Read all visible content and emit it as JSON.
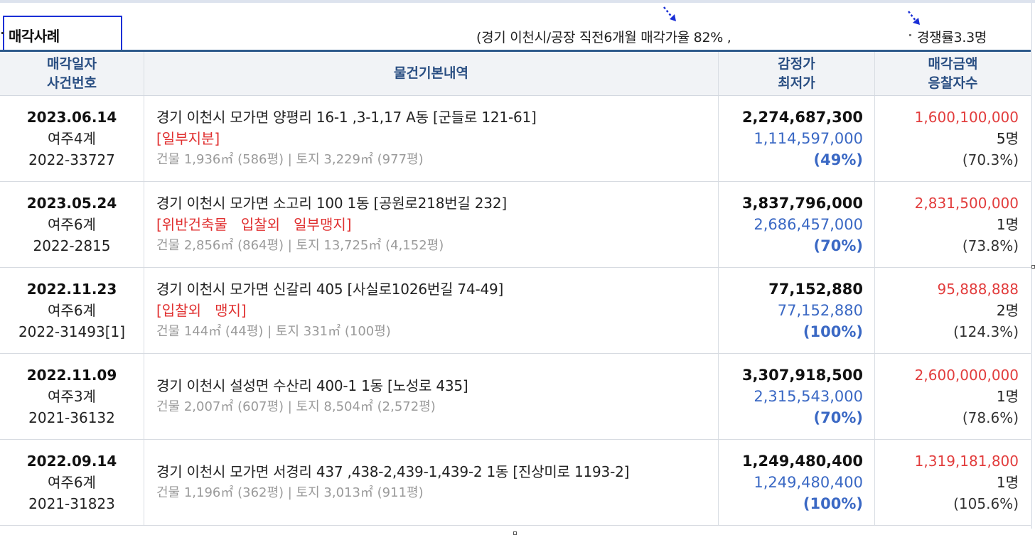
{
  "header": {
    "title": "매각사례",
    "summary": "(경기 이천시/공장 직전6개월 매각가율 82% ,",
    "competition": "경쟁률3.3명",
    "accent_color": "#1a2fd6"
  },
  "columns": {
    "date": [
      "매각일자",
      "사건번호"
    ],
    "info": "물건기본내역",
    "price": [
      "감정가",
      "최저가"
    ],
    "sale": [
      "매각금액",
      "응찰자수"
    ]
  },
  "rows": [
    {
      "date": "2023.06.14",
      "court": "여주4계",
      "case": "2022-33727",
      "address": "경기 이천시 모가면 양평리 16-1 ,3-1,17 A동 [군들로 121-61]",
      "tags": "[일부지분]",
      "area": "건물 1,936㎡ (586평) | 토지 3,229㎡ (977평)",
      "appraisal": "2,274,687,300",
      "minimum": "1,114,597,000",
      "min_pct": "(49%)",
      "sale_price": "1,600,100,000",
      "bidders": "5명",
      "ratio": "(70.3%)"
    },
    {
      "date": "2023.05.24",
      "court": "여주6계",
      "case": "2022-2815",
      "address": "경기 이천시 모가면 소고리 100 1동 [공원로218번길 232]",
      "tags": "[위반건축물   입찰외   일부맹지]",
      "area": "건물 2,856㎡ (864평) | 토지 13,725㎡ (4,152평)",
      "appraisal": "3,837,796,000",
      "minimum": "2,686,457,000",
      "min_pct": "(70%)",
      "sale_price": "2,831,500,000",
      "bidders": "1명",
      "ratio": "(73.8%)"
    },
    {
      "date": "2022.11.23",
      "court": "여주6계",
      "case": "2022-31493[1]",
      "address": "경기 이천시 모가면 신갈리 405 [사실로1026번길 74-49]",
      "tags": "[입찰외   맹지]",
      "area": "건물 144㎡ (44평) | 토지 331㎡ (100평)",
      "appraisal": "77,152,880",
      "minimum": "77,152,880",
      "min_pct": "(100%)",
      "sale_price": "95,888,888",
      "bidders": "2명",
      "ratio": "(124.3%)"
    },
    {
      "date": "2022.11.09",
      "court": "여주3계",
      "case": "2021-36132",
      "address": "경기 이천시 설성면 수산리 400-1 1동 [노성로 435]",
      "tags": "",
      "area": "건물 2,007㎡ (607평) | 토지 8,504㎡ (2,572평)",
      "appraisal": "3,307,918,500",
      "minimum": "2,315,543,000",
      "min_pct": "(70%)",
      "sale_price": "2,600,000,000",
      "bidders": "1명",
      "ratio": "(78.6%)"
    },
    {
      "date": "2022.09.14",
      "court": "여주6계",
      "case": "2021-31823",
      "address": "경기 이천시 모가면 서경리 437 ,438-2,439-1,439-2 1동 [진상미로 1193-2]",
      "tags": "",
      "area": "건물 1,196㎡ (362평) | 토지 3,013㎡ (911평)",
      "appraisal": "1,249,480,400",
      "minimum": "1,249,480,400",
      "min_pct": "(100%)",
      "sale_price": "1,319,181,800",
      "bidders": "1명",
      "ratio": "(105.6%)"
    }
  ]
}
